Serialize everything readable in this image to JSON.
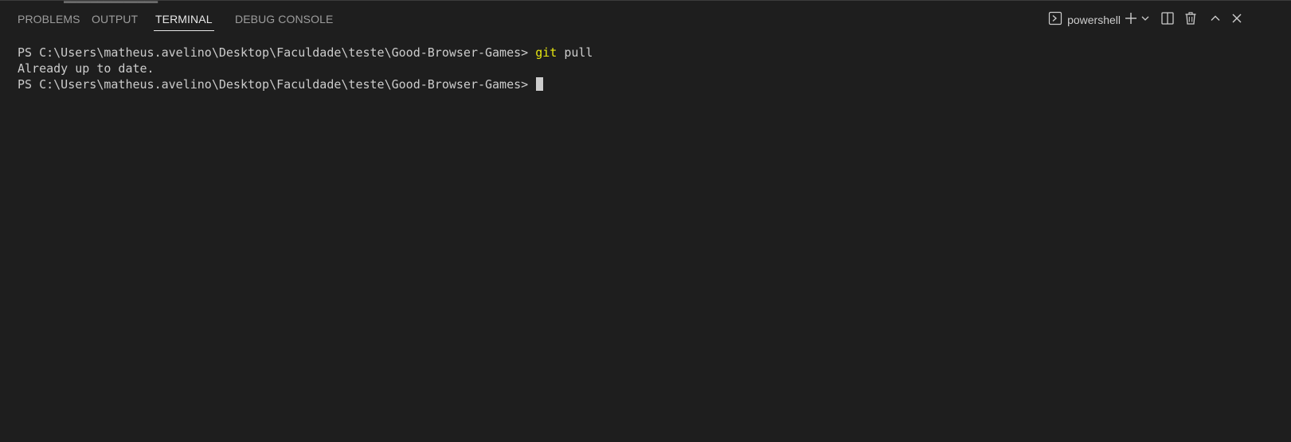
{
  "tabs": [
    {
      "label": "PROBLEMS",
      "active": false
    },
    {
      "label": "OUTPUT",
      "active": false
    },
    {
      "label": "TERMINAL",
      "active": true
    },
    {
      "label": "DEBUG CONSOLE",
      "active": false
    }
  ],
  "toolbar": {
    "shell_name": "powershell",
    "icons": [
      "terminal-icon",
      "plus-icon",
      "chevron-down-icon",
      "split-icon",
      "trash-icon",
      "chevron-up-icon",
      "close-icon"
    ]
  },
  "terminal": {
    "lines": [
      {
        "prompt": "PS C:\\Users\\matheus.avelino\\Desktop\\Faculdade\\teste\\Good-Browser-Games> ",
        "command": "git",
        "args": " pull"
      },
      {
        "output": "Already up to date."
      },
      {
        "prompt": "PS C:\\Users\\matheus.avelino\\Desktop\\Faculdade\\teste\\Good-Browser-Games> "
      }
    ]
  },
  "colors": {
    "background": "#1e1e1e",
    "text": "#cccccc",
    "command": "#e5e510",
    "tab_inactive": "#9d9d9d",
    "tab_active": "#e7e7e7"
  }
}
